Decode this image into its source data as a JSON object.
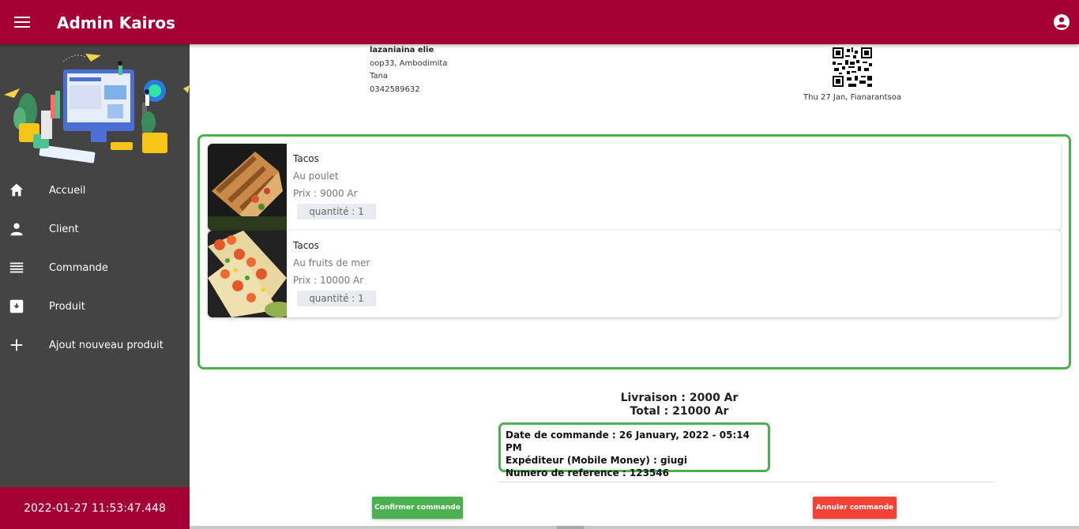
{
  "appbar": {
    "title": "Admin Kairos",
    "color": "#a50034"
  },
  "sidebar": {
    "items": [
      {
        "label": "Accueil",
        "icon": "home-icon"
      },
      {
        "label": "Client",
        "icon": "person-icon"
      },
      {
        "label": "Commande",
        "icon": "list-icon"
      },
      {
        "label": "Produit",
        "icon": "archive-icon"
      },
      {
        "label": "Ajout nouveau produit",
        "icon": "plus-icon"
      }
    ],
    "footer_datetime": "2022-01-27 11:53:47.448"
  },
  "client": {
    "name": "lazaniaina elie",
    "address": "oop33, Ambodimita",
    "city": "Tana",
    "phone": "0342589632"
  },
  "order_header": {
    "date_location": "Thu 27 Jan, Fianarantsoa"
  },
  "items": [
    {
      "name": "Tacos",
      "description": "Au poulet",
      "price": "Prix : 9000 Ar",
      "quantity": "quantité : 1"
    },
    {
      "name": "Tacos",
      "description": "Au fruits de mer",
      "price": "Prix : 10000 Ar",
      "quantity": "quantité : 1"
    }
  ],
  "totals": {
    "delivery": "Livraison : 2000 Ar",
    "total": "Total : 21000 Ar"
  },
  "order_details": {
    "order_date": "Date de commande : 26 January, 2022 - 05:14 PM",
    "sender": "Expéditeur (Mobile Money) : giugi",
    "reference": "Numero de reference : 123546"
  },
  "actions": {
    "confirm_label": "Confirmer commande",
    "cancel_label": "Annuler commande",
    "confirm_color": "#4caf50",
    "cancel_color": "#f44336"
  }
}
